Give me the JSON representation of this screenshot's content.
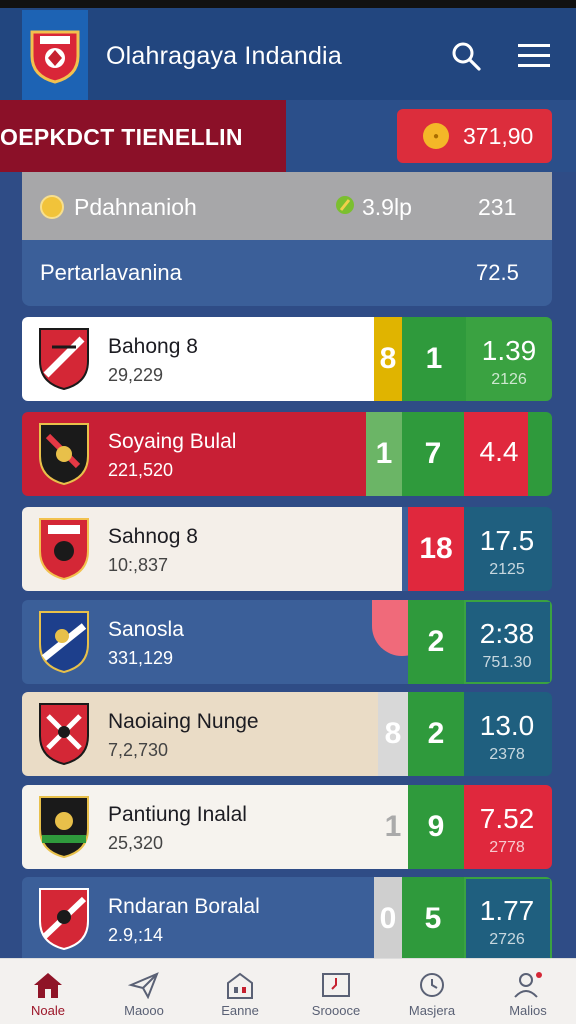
{
  "header": {
    "title": "Olahragaya Indandia",
    "search_icon": "search-icon",
    "menu_icon": "menu-icon"
  },
  "banner": {
    "title": "OEPKDCT TIENELLIN",
    "badge_value": "371,90"
  },
  "summary": {
    "row1_label": "Pdahnanioh",
    "row1_mid": "3.9lp",
    "row1_right": "231",
    "row2_label": "Pertarlavanina",
    "row2_right": "72.5"
  },
  "matches": [
    {
      "name": "Bahong 8",
      "sub": "29,229",
      "seg1": "8",
      "seg2": "1",
      "odds": "1.39",
      "odds_sub": "2126",
      "odds_color": "#3aa241"
    },
    {
      "name": "Soyaing Bulal",
      "sub": "221,520",
      "seg1": "1",
      "seg2": "7",
      "odds": "4.4",
      "odds_sub": "",
      "odds_color": "#e0283d"
    },
    {
      "name": "Sahnog 8",
      "sub": "10:,837",
      "seg1": "",
      "seg2": "18",
      "odds": "17.5",
      "odds_sub": "2125",
      "odds_color": "#1f5f7f"
    },
    {
      "name": "Sanosla",
      "sub": "331,129",
      "seg1": "",
      "seg2": "2",
      "odds": "2:38",
      "odds_sub": "751.30",
      "odds_color": "#1f5f7f"
    },
    {
      "name": "Naoiaing Nunge",
      "sub": "7,2,730",
      "seg1": "8",
      "seg2": "2",
      "odds": "13.0",
      "odds_sub": "2378",
      "odds_color": "#1f5f7f"
    },
    {
      "name": "Pantiung Inalal",
      "sub": "25,320",
      "seg1": "1",
      "seg2": "9",
      "odds": "7.52",
      "odds_sub": "2778",
      "odds_color": "#e0283d"
    },
    {
      "name": "Rndaran Boralal",
      "sub": "2.9,:14",
      "seg1": "0",
      "seg2": "5",
      "odds": "1.77",
      "odds_sub": "2726",
      "odds_color": "#1f5f7f"
    }
  ],
  "nav": [
    {
      "label": "Noale",
      "icon": "home-icon",
      "active": true
    },
    {
      "label": "Maooo",
      "icon": "paper-plane-icon",
      "active": false
    },
    {
      "label": "Eanne",
      "icon": "building-icon",
      "active": false
    },
    {
      "label": "Sroooce",
      "icon": "scoreboard-icon",
      "active": false
    },
    {
      "label": "Masjera",
      "icon": "clock-icon",
      "active": false
    },
    {
      "label": "Malios",
      "icon": "user-icon",
      "active": false
    }
  ]
}
